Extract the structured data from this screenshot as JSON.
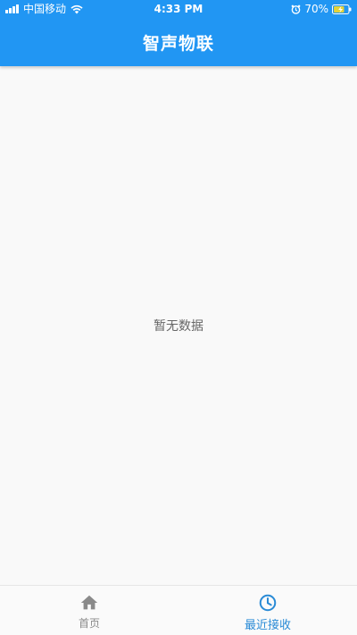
{
  "status_bar": {
    "carrier": "中国移动",
    "time": "4:33 PM",
    "battery_percent": "70%",
    "icons": [
      "signal-icon",
      "wifi-icon",
      "alarm-icon",
      "battery-charging-icon"
    ]
  },
  "app_bar": {
    "title": "智声物联",
    "background_color": "#2196f3"
  },
  "content": {
    "empty_message": "暂无数据"
  },
  "bottom_nav": {
    "items": [
      {
        "label": "首页",
        "icon": "home-icon",
        "active": false
      },
      {
        "label": "最近接收",
        "icon": "clock-icon",
        "active": true
      }
    ],
    "active_color": "#2a8bd6",
    "inactive_color": "#8a8a8a"
  }
}
